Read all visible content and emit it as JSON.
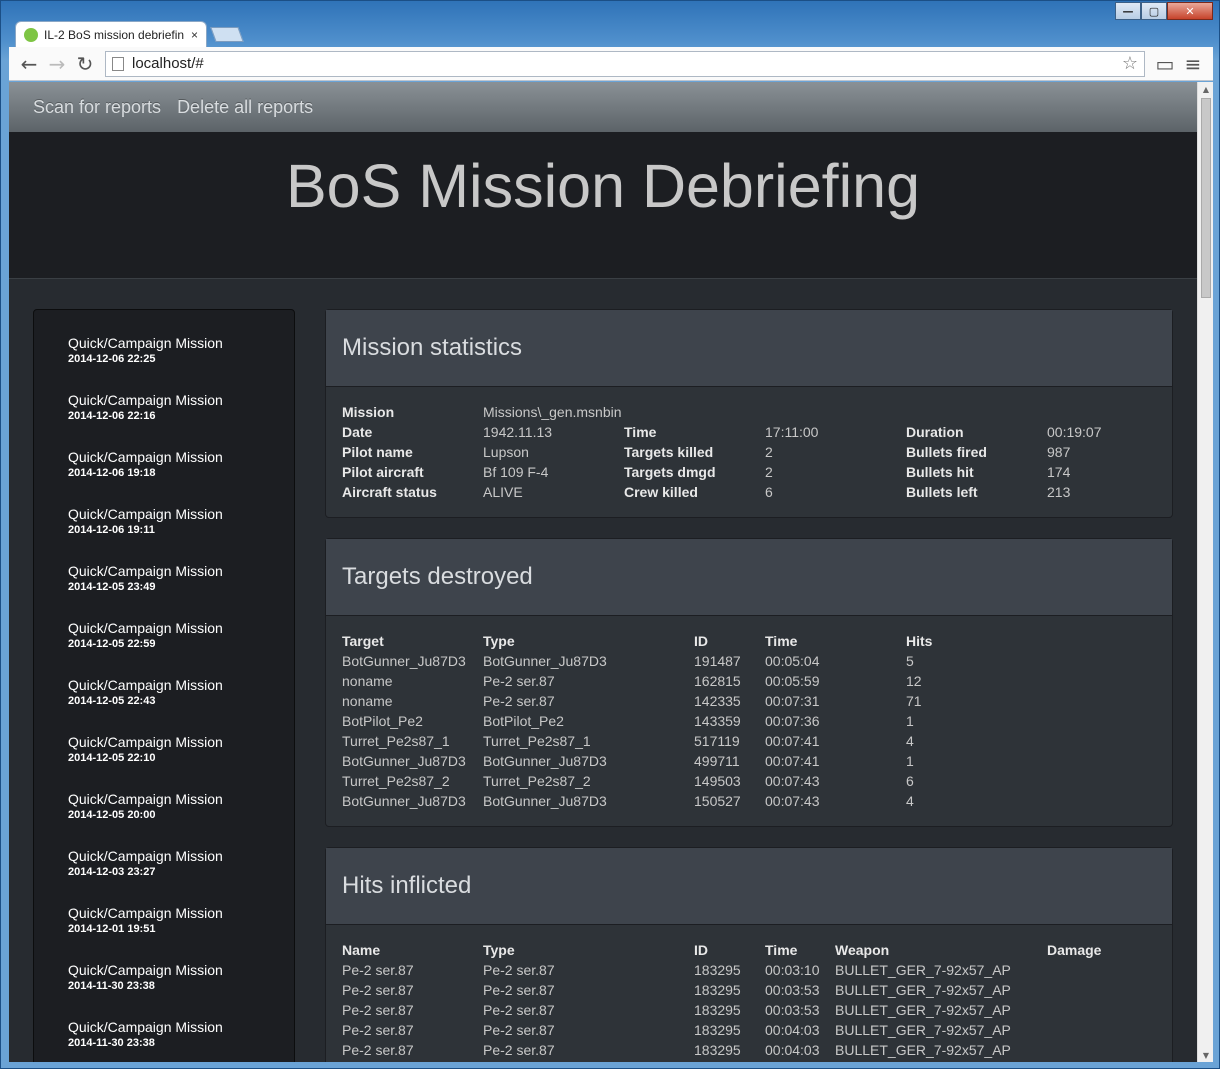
{
  "browser": {
    "tab_title": "IL-2 BoS mission debriefin",
    "tab_close": "×",
    "url": "localhost/#",
    "win_minimize": "—",
    "win_maximize": "▢",
    "win_close": "✕"
  },
  "navbar": {
    "scan": "Scan for reports",
    "delete": "Delete all reports"
  },
  "header": {
    "title": "BoS Mission Debriefing"
  },
  "sidebar": {
    "items": [
      {
        "title": "Quick/Campaign Mission",
        "date": "2014-12-06 22:25"
      },
      {
        "title": "Quick/Campaign Mission",
        "date": "2014-12-06 22:16"
      },
      {
        "title": "Quick/Campaign Mission",
        "date": "2014-12-06 19:18"
      },
      {
        "title": "Quick/Campaign Mission",
        "date": "2014-12-06 19:11"
      },
      {
        "title": "Quick/Campaign Mission",
        "date": "2014-12-05 23:49"
      },
      {
        "title": "Quick/Campaign Mission",
        "date": "2014-12-05 22:59"
      },
      {
        "title": "Quick/Campaign Mission",
        "date": "2014-12-05 22:43"
      },
      {
        "title": "Quick/Campaign Mission",
        "date": "2014-12-05 22:10"
      },
      {
        "title": "Quick/Campaign Mission",
        "date": "2014-12-05 20:00"
      },
      {
        "title": "Quick/Campaign Mission",
        "date": "2014-12-03 23:27"
      },
      {
        "title": "Quick/Campaign Mission",
        "date": "2014-12-01 19:51"
      },
      {
        "title": "Quick/Campaign Mission",
        "date": "2014-11-30 23:38"
      },
      {
        "title": "Quick/Campaign Mission",
        "date": "2014-11-30 23:38"
      }
    ]
  },
  "stats": {
    "heading": "Mission statistics",
    "mission_label": "Mission",
    "mission": "Missions\\_gen.msnbin",
    "date_label": "Date",
    "date": "1942.11.13",
    "time_label": "Time",
    "time": "17:11:00",
    "duration_label": "Duration",
    "duration": "00:19:07",
    "pilot_label": "Pilot name",
    "pilot": "Lupson",
    "targets_killed_label": "Targets killed",
    "targets_killed": "2",
    "bullets_fired_label": "Bullets fired",
    "bullets_fired": "987",
    "aircraft_label": "Pilot aircraft",
    "aircraft": "Bf 109 F-4",
    "targets_dmgd_label": "Targets dmgd",
    "targets_dmgd": "2",
    "bullets_hit_label": "Bullets hit",
    "bullets_hit": "174",
    "status_label": "Aircraft status",
    "status": "ALIVE",
    "crew_killed_label": "Crew killed",
    "crew_killed": "6",
    "bullets_left_label": "Bullets left",
    "bullets_left": "213"
  },
  "targets": {
    "heading": "Targets destroyed",
    "columns": [
      "Target",
      "Type",
      "ID",
      "Time",
      "Hits"
    ],
    "rows": [
      [
        "BotGunner_Ju87D3",
        "BotGunner_Ju87D3",
        "191487",
        "00:05:04",
        "5"
      ],
      [
        "noname",
        "Pe-2 ser.87",
        "162815",
        "00:05:59",
        "12"
      ],
      [
        "noname",
        "Pe-2 ser.87",
        "142335",
        "00:07:31",
        "71"
      ],
      [
        "BotPilot_Pe2",
        "BotPilot_Pe2",
        "143359",
        "00:07:36",
        "1"
      ],
      [
        "Turret_Pe2s87_1",
        "Turret_Pe2s87_1",
        "517119",
        "00:07:41",
        "4"
      ],
      [
        "BotGunner_Ju87D3",
        "BotGunner_Ju87D3",
        "499711",
        "00:07:41",
        "1"
      ],
      [
        "Turret_Pe2s87_2",
        "Turret_Pe2s87_2",
        "149503",
        "00:07:43",
        "6"
      ],
      [
        "BotGunner_Ju87D3",
        "BotGunner_Ju87D3",
        "150527",
        "00:07:43",
        "4"
      ]
    ]
  },
  "hits": {
    "heading": "Hits inflicted",
    "columns": [
      "Name",
      "Type",
      "ID",
      "Time",
      "Weapon",
      "Damage"
    ],
    "rows": [
      [
        "Pe-2 ser.87",
        "Pe-2 ser.87",
        "183295",
        "00:03:10",
        "BULLET_GER_7-92x57_AP",
        ""
      ],
      [
        "Pe-2 ser.87",
        "Pe-2 ser.87",
        "183295",
        "00:03:53",
        "BULLET_GER_7-92x57_AP",
        ""
      ],
      [
        "Pe-2 ser.87",
        "Pe-2 ser.87",
        "183295",
        "00:03:53",
        "BULLET_GER_7-92x57_AP",
        ""
      ],
      [
        "Pe-2 ser.87",
        "Pe-2 ser.87",
        "183295",
        "00:04:03",
        "BULLET_GER_7-92x57_AP",
        ""
      ],
      [
        "Pe-2 ser.87",
        "Pe-2 ser.87",
        "183295",
        "00:04:03",
        "BULLET_GER_7-92x57_AP",
        ""
      ]
    ]
  }
}
